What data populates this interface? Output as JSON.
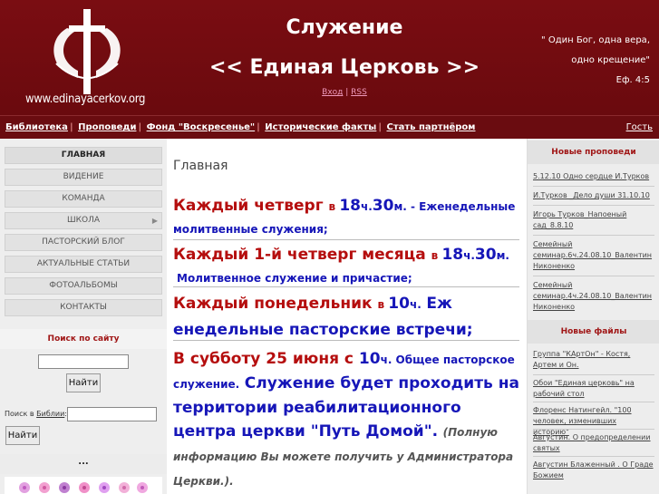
{
  "header": {
    "site_url": "www.edinayacerkov.org",
    "title_line1": "Служение",
    "title_line2": "<< Единая Церковь >>",
    "login_link": "Вход",
    "link_separator": "|",
    "rss_link": "RSS",
    "quote_line1": "\" Один Бог, одна вера,",
    "quote_line2": "одно крещение\"",
    "quote_ref": "Еф. 4:5",
    "brand_color": "#6a0a0e"
  },
  "nav": {
    "items": [
      "Библиотека",
      "Проповеди",
      "Фонд \"Воскресенье\"",
      "Исторические факты",
      "Стать партнёром"
    ],
    "separator": "|",
    "guest": "Гость"
  },
  "left_menu": {
    "items": [
      "Главная",
      "Видение",
      "Команда",
      "Школа",
      "Пасторский блог",
      "Актуальные статьи",
      "Фотоальбомы",
      "Контакты"
    ],
    "active_index": 0,
    "submenu_icon": "chevron-right-icon"
  },
  "search": {
    "title": "Поиск по сайту",
    "value": "",
    "button": "Найти",
    "bible_label_prefix": "Поиск в",
    "bible_label_link": "Библии",
    "bible_label_suffix": ":",
    "bible_value": "",
    "bible_button": "Найти"
  },
  "extra": {
    "dots_title": "..."
  },
  "main": {
    "heading": "Главная",
    "notice1": {
      "a": "Каждый четверг ",
      "b": "в ",
      "c": "18",
      "d": "ч.",
      "e": "30",
      "f": "м. - ",
      "g": "Еженедельные молитвенные служения;"
    },
    "notice2": {
      "a": "Каждый 1-й четверг месяца ",
      "b": "в ",
      "c": "18",
      "d": "ч.",
      "e": "30",
      "f": "м.",
      "g": "Молитвенное служение и причастие;"
    },
    "notice3": {
      "a": "Каждый понедельник ",
      "b": "в ",
      "c": "10",
      "d": "ч.",
      "e": "Еж",
      "f": "енедельные пасторские встречи;"
    },
    "notice4": {
      "a": "В субботу 25 июня с ",
      "b": "10",
      "c": "ч. Общее пасторское служение.",
      "d": "Служение будет проходить на территории реабилитационного центра церкви \"Путь Домой\".",
      "e": "(Полную информацию Вы можете получить у Администратора Церкви.)",
      "f": "."
    },
    "accent_red": "#b50e0e",
    "accent_blue": "#1616b8"
  },
  "right": {
    "sermons_title": "Новые проповеди",
    "sermons": [
      "5.12.10 Одно сердце И.Турков",
      "И.Турков _Дело души 31.10.10",
      "Игорь Турков_Напоеный сад_8.8.10",
      "Семейный семинар.6ч.24.08.10_Валентин Никоненко",
      "Семейный семинар.4ч.24.08.10_Валентин Никоненко"
    ],
    "files_title": "Новые файлы",
    "files": [
      "Группа \"КАртОн\" - Костя, Артем и Он.",
      "Обои \"Единая церковь\" на рабочий стол",
      "Флоренс Натингейл. \"100 человек, изменивших историю\"",
      "Августин. О предопределении святых",
      "Августин Блаженный . О Граде Божием"
    ]
  }
}
